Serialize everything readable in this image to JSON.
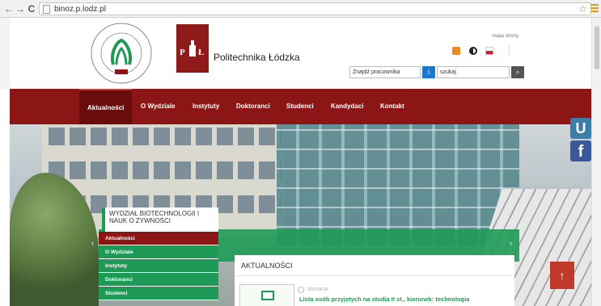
{
  "browser": {
    "back_icon": "back-arrow-icon",
    "forward_icon": "forward-arrow-icon",
    "reload_icon": "reload-icon",
    "url": "binoz.p.lodz.pl",
    "back_glyph": "←",
    "forward_glyph": "→",
    "reload_glyph": "C",
    "star_glyph": "☆"
  },
  "header": {
    "university_name": "Politechnika Łódzka",
    "site_map": "mapa strony",
    "employee_search_placeholder": "Znajdź pracownika",
    "site_search_placeholder": "szukaj",
    "employee_btn_glyph": "i",
    "search_btn_glyph": "⌕"
  },
  "nav": {
    "items": [
      "Aktualności",
      "O Wydziale",
      "Instytuty",
      "Doktoranci",
      "Studenci",
      "Kandydaci",
      "Kontakt"
    ]
  },
  "side": {
    "title": "Wydział Biotechnologii i Nauk o Żywności",
    "items": [
      "Aktualności",
      "O Wydziale",
      "Instytuty",
      "Doktoranci",
      "Studenci"
    ]
  },
  "news": {
    "heading": "AKTUALNOŚCI",
    "date": "2015-09-29",
    "title": "Lista osób przyjętych na studia II st., kierunek: technologia"
  },
  "floating": {
    "u_label": "U",
    "f_label": "f",
    "top_glyph": "↑"
  },
  "colors": {
    "brand_red": "#8c1515",
    "brand_green": "#1f9a56"
  }
}
